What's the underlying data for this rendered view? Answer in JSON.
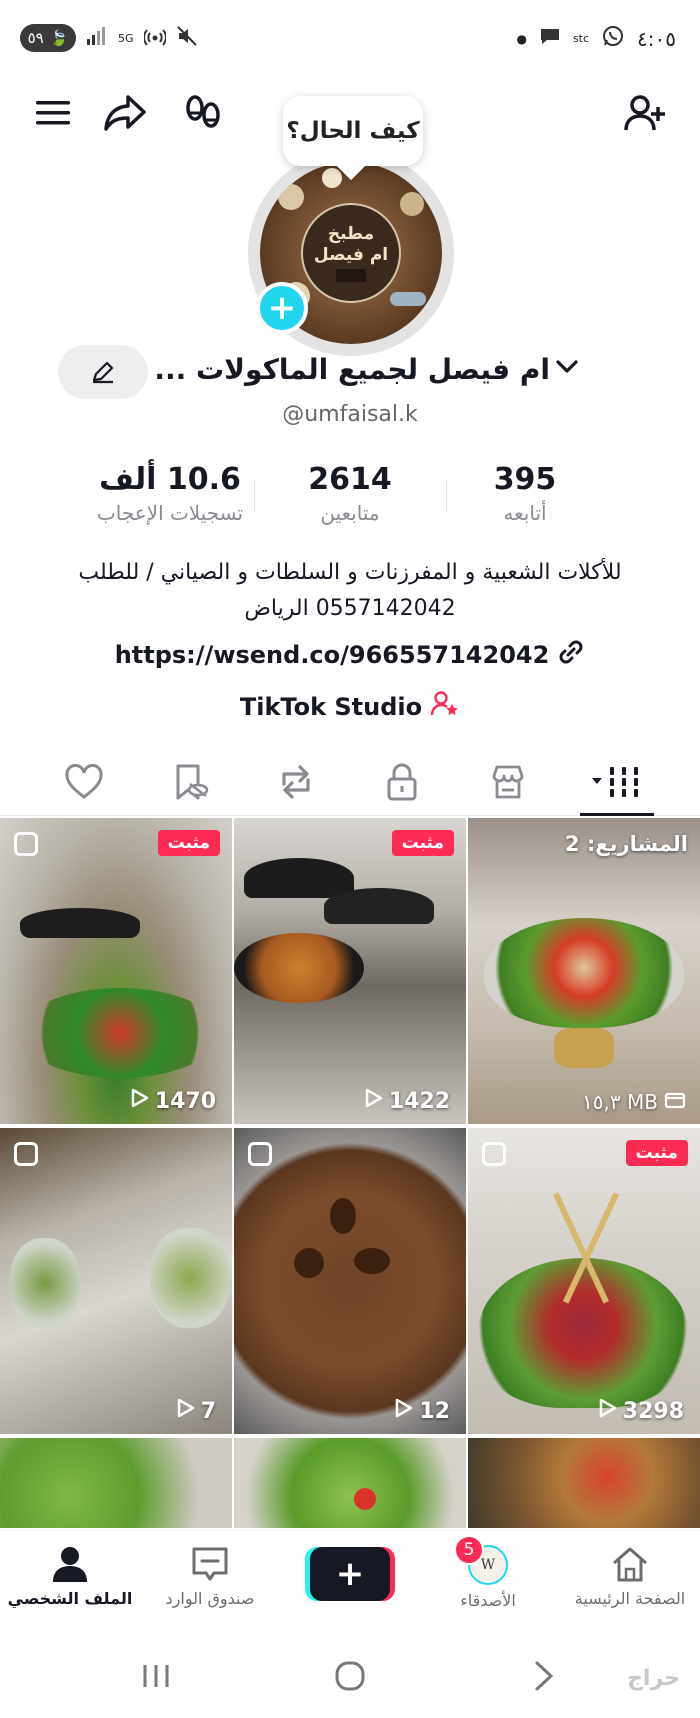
{
  "status_bar": {
    "time": "٤:٠٥",
    "battery": "٥٩",
    "carrier": "stc",
    "network": "5G"
  },
  "bubble": {
    "text": "كيف الحال؟"
  },
  "avatar": {
    "title": "مطبخ",
    "subtitle": "ام فيصل"
  },
  "profile": {
    "name": "ام فيصل لجميع الماكولات ...",
    "username": "@umfaisal.k"
  },
  "stats": {
    "likes": {
      "value": "10.6 ألف",
      "label": "تسجيلات الإعجاب"
    },
    "followers": {
      "value": "2614",
      "label": "متابعين"
    },
    "following": {
      "value": "395",
      "label": "أتابعه"
    }
  },
  "bio": {
    "line1": "للأكلات الشعبية و المفرزنات و السلطات و الصياني / للطلب",
    "line2": "0557142042 الرياض",
    "link": "https://wsend.co/966557142042",
    "studio": "TikTok Studio"
  },
  "videos": [
    {
      "pinned_label": "مثبت",
      "views": "1470"
    },
    {
      "pinned_label": "مثبت",
      "views": "1422"
    },
    {
      "projects_label": "المشاريع: 2",
      "storage": "١٥,٣ MB"
    },
    {
      "views": "7"
    },
    {
      "views": "12"
    },
    {
      "pinned_label": "مثبت",
      "views": "3298"
    }
  ],
  "bottom_nav": {
    "home": "الصفحة الرئيسية",
    "friends": "الأصدقاء",
    "friends_badge": "5",
    "inbox": "صندوق الوارد",
    "profile": "الملف الشخصي"
  },
  "watermark": "حراج",
  "colors": {
    "accent_pink": "#fe2c55",
    "accent_cyan": "#20d5ec",
    "text": "#161823"
  }
}
